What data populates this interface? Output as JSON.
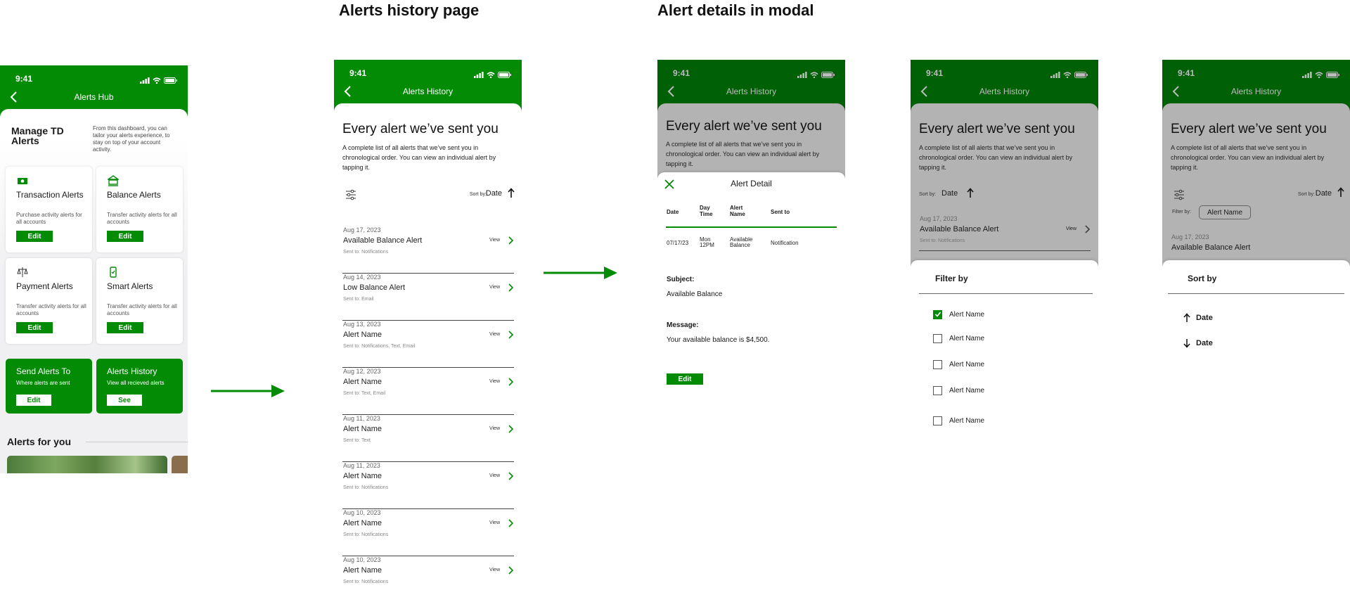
{
  "headings": {
    "history": "Alerts history page",
    "details": "Alert details in modal"
  },
  "status_time": "9:41",
  "hub": {
    "title": "Alerts Hub",
    "manage_title": "Manage TD Alerts",
    "manage_desc": "From this dashboard, you can tailor your alerts experience, to stay on top of your account activity.",
    "cards": [
      {
        "title": "Transaction Alerts",
        "subtitle": "Purchase activity alerts for all accounts",
        "button": "Edit",
        "icon": "money-icon"
      },
      {
        "title": "Balance Alerts",
        "subtitle": "Transfer activity alerts for all accounts",
        "button": "Edit",
        "icon": "bank-icon"
      },
      {
        "title": "Payment Alerts",
        "subtitle": "Transfer activity alerts for all accounts",
        "button": "Edit",
        "icon": "scale-icon"
      },
      {
        "title": "Smart Alerts",
        "subtitle": "Transfer activity alerts for all accounts",
        "button": "Edit",
        "icon": "phone-icon"
      }
    ],
    "green_cards": [
      {
        "title": "Send Alerts To",
        "subtitle": "Where alerts are sent",
        "button": "Edit"
      },
      {
        "title": "Alerts History",
        "subtitle": "View all recieved alerts",
        "button": "See"
      }
    ],
    "alerts_for_you": "Alerts for you"
  },
  "history": {
    "title": "Alerts History",
    "heading": "Every alert we’ve sent you",
    "desc": "A complete list of all alerts that we’ve sent you in chronological order. You can view an individual alert by tapping it.",
    "sort_label": "Sort by:",
    "sort_value": "Date",
    "view_label": "View",
    "rows": [
      {
        "date": "Aug 17, 2023",
        "name": "Available Balance Alert",
        "sent": "Sent to: Notifications"
      },
      {
        "date": "Aug 14, 2023",
        "name": "Low Balance Alert",
        "sent": "Sent to: Email"
      },
      {
        "date": "Aug 13, 2023",
        "name": "Alert Name",
        "sent": "Sent to: Notifications, Text, Email"
      },
      {
        "date": "Aug 12, 2023",
        "name": "Alert Name",
        "sent": "Sent to: Text, Email"
      },
      {
        "date": "Aug 11, 2023",
        "name": "Alert Name",
        "sent": "Sent to: Text"
      },
      {
        "date": "Aug 11, 2023",
        "name": "Alert Name",
        "sent": "Sent to: Notifications"
      },
      {
        "date": "Aug 10, 2023",
        "name": "Alert Name",
        "sent": "Sent to: Notifications"
      },
      {
        "date": "Aug 10, 2023",
        "name": "Alert Name",
        "sent": "Sent to: Notifications"
      }
    ]
  },
  "modal": {
    "title": "Alert Detail",
    "cols": [
      "Date",
      "Day Time",
      "Alert Name",
      "Sent to"
    ],
    "row": [
      "07/17/23",
      "Mon 12PM",
      "Available Balance",
      "Notification"
    ],
    "subject_label": "Subject:",
    "subject": "Available Balance",
    "message_label": "Message:",
    "message": "Your available balance is $4,500.",
    "edit": "Edit"
  },
  "filter": {
    "title": "Filter by",
    "behind_row": {
      "date": "Aug 17, 2023",
      "name": "Available Balance Alert",
      "sent": "Sent to: Notifications"
    },
    "options": [
      {
        "label": "Alert Name",
        "checked": true
      },
      {
        "label": "Alert Name",
        "checked": false
      },
      {
        "label": "Alert Name",
        "checked": false
      },
      {
        "label": "Alert Name",
        "checked": false
      },
      {
        "label": "Alert Name",
        "checked": false
      }
    ]
  },
  "sortsheet": {
    "title": "Sort by",
    "filter_label": "Filter by:",
    "filter_pill": "Alert Name",
    "behind_row": {
      "date": "Aug 17, 2023",
      "name": "Available Balance Alert"
    },
    "options": [
      {
        "label": "Date",
        "direction": "up"
      },
      {
        "label": "Date",
        "direction": "down"
      }
    ]
  },
  "colors": {
    "brand_green": "#038b06",
    "dark_green": "#006006",
    "overlay_gray": "#b3b3b3"
  }
}
